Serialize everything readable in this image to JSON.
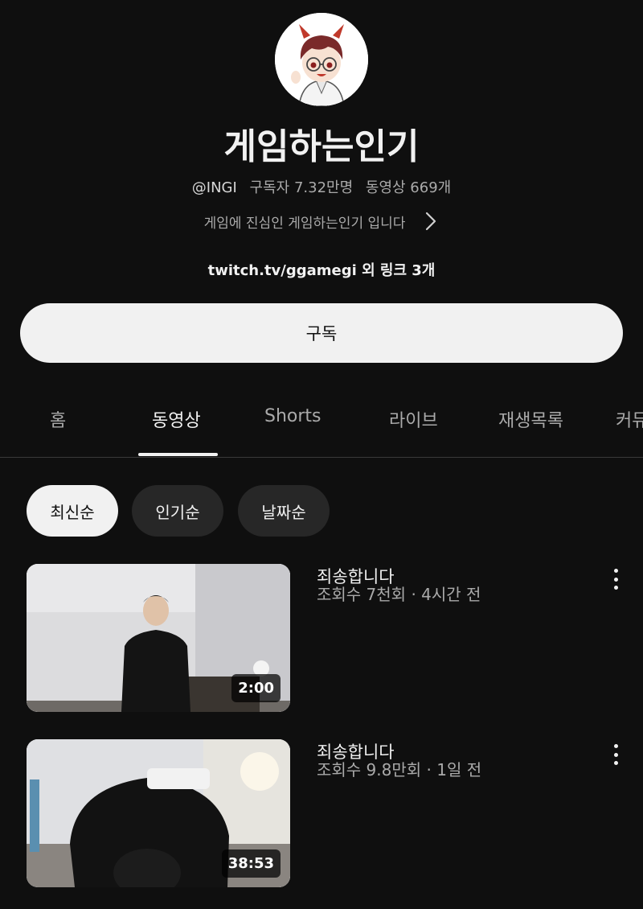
{
  "channel": {
    "name": "게임하는인기",
    "handle": "@INGI",
    "subscribers": "구독자 7.32만명",
    "video_count": "동영상 669개",
    "description": "게임에 진심인 게임하는인기 입니다",
    "links": "twitch.tv/ggamegi 외 링크 3개",
    "avatar_icon": "avatar-icon"
  },
  "subscribe_label": "구독",
  "tabs": [
    {
      "label": "홈",
      "active": false
    },
    {
      "label": "동영상",
      "active": true
    },
    {
      "label": "Shorts",
      "active": false
    },
    {
      "label": "라이브",
      "active": false
    },
    {
      "label": "재생목록",
      "active": false
    },
    {
      "label": "커뮤",
      "active": false
    }
  ],
  "filters": [
    {
      "label": "최신순",
      "active": true
    },
    {
      "label": "인기순",
      "active": false
    },
    {
      "label": "날짜순",
      "active": false
    }
  ],
  "videos": [
    {
      "title": "죄송합니다",
      "meta": "조회수 7천회 · 4시간 전",
      "duration": "2:00"
    },
    {
      "title": "죄송합니다",
      "meta": "조회수 9.8만회 · 1일 전",
      "duration": "38:53"
    }
  ],
  "colors": {
    "background": "#0f0f0f",
    "text_primary": "#f1f1f1",
    "text_secondary": "#aaaaaa",
    "chip_bg": "#272727"
  }
}
